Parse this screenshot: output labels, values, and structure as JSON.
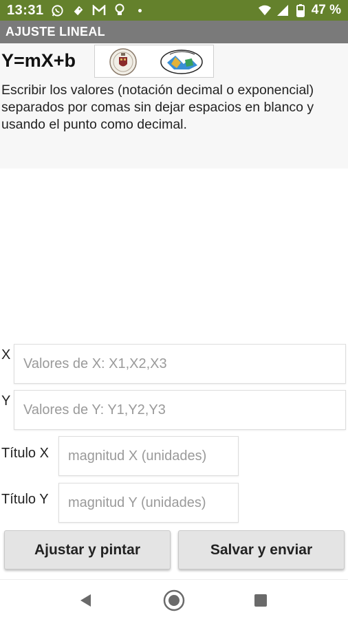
{
  "status_bar": {
    "time": "13:31",
    "battery": "47 %",
    "icons": [
      "whatsapp-icon",
      "notification-icon",
      "gmail-icon",
      "lightbulb-icon",
      "dot-icon",
      "wifi-icon",
      "signal-icon",
      "battery-icon"
    ]
  },
  "app_bar": {
    "title": "AJUSTE LINEAL"
  },
  "header": {
    "formula": "Y=mX+b",
    "logos": [
      "university-seal-logo",
      "lab-logo"
    ],
    "instructions": "Escribir los valores (notación decimal o exponencial) separados por comas sin dejar espacios en blanco y usando el punto como decimal."
  },
  "form": {
    "x": {
      "label": "X",
      "placeholder": "Valores de X: X1,X2,X3",
      "value": ""
    },
    "y": {
      "label": "Y",
      "placeholder": "Valores de Y: Y1,Y2,Y3",
      "value": ""
    },
    "title_x": {
      "label": "Título X",
      "placeholder": "magnitud X (unidades)",
      "value": ""
    },
    "title_y": {
      "label": "Título Y",
      "placeholder": "magnitud Y (unidades)",
      "value": ""
    }
  },
  "buttons": {
    "fit": "Ajustar y pintar",
    "save": "Salvar y enviar"
  },
  "nav": {
    "icons": [
      "back-icon",
      "home-icon",
      "recents-icon"
    ]
  },
  "colors": {
    "status_bar": "#64812c",
    "app_bar": "#7a7a7a",
    "header_bg": "#f7f7f7",
    "button_bg": "#e4e4e4"
  }
}
